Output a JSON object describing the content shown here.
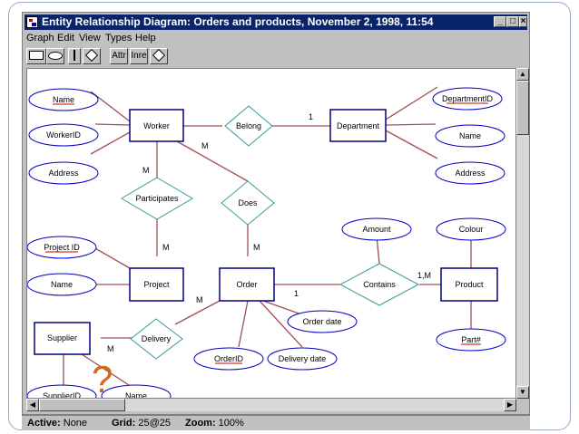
{
  "window": {
    "title": "Entity Relationship Diagram: Orders and products, November 2, 1998, 11:54"
  },
  "menu": [
    "Graph",
    "Edit",
    "View",
    "Types",
    "Help"
  ],
  "toolbar": {
    "attr_label": "Attr",
    "inre_label": "Inre"
  },
  "status": {
    "active_label": "Active:",
    "active_value": "None",
    "grid_label": "Grid:",
    "grid_value": "25@25",
    "zoom_label": "Zoom:",
    "zoom_value": "100%"
  },
  "diagram": {
    "entities": {
      "worker": "Worker",
      "department": "Department",
      "project": "Project",
      "order": "Order",
      "product": "Product",
      "supplier": "Supplier"
    },
    "relationships": {
      "belong": "Belong",
      "participates": "Participates",
      "does": "Does",
      "contains": "Contains",
      "delivery": "Delivery"
    },
    "attributes": {
      "name_worker": "Name",
      "workerid": "WorkerID",
      "address_worker": "Address",
      "departmentid": "DepartmentID",
      "name_dept": "Name",
      "address_dept": "Address",
      "project_id": "Project ID",
      "name_project": "Name",
      "amount": "Amount",
      "colour": "Colour",
      "order_date": "Order date",
      "orderid": "OrderID",
      "delivery_date": "Delivery date",
      "part": "Part#",
      "supplierid": "SupplierID",
      "name_supplier": "Name"
    },
    "cardinalities": {
      "worker_belong": "M",
      "belong_department": "1",
      "worker_participates": "M",
      "participates_project": "M",
      "does_order": "M",
      "order_contains": "1",
      "contains_product": "1,M",
      "order_delivery": "M",
      "delivery_supplier": "M"
    },
    "overlay_mark": "?"
  },
  "colors": {
    "entity_border": "#000080",
    "relationship_border": "#3a9a9a",
    "attribute_border": "#0000c0",
    "key_underline": "#c00000",
    "connector": "#a05050",
    "question_mark": "#d2691e"
  }
}
